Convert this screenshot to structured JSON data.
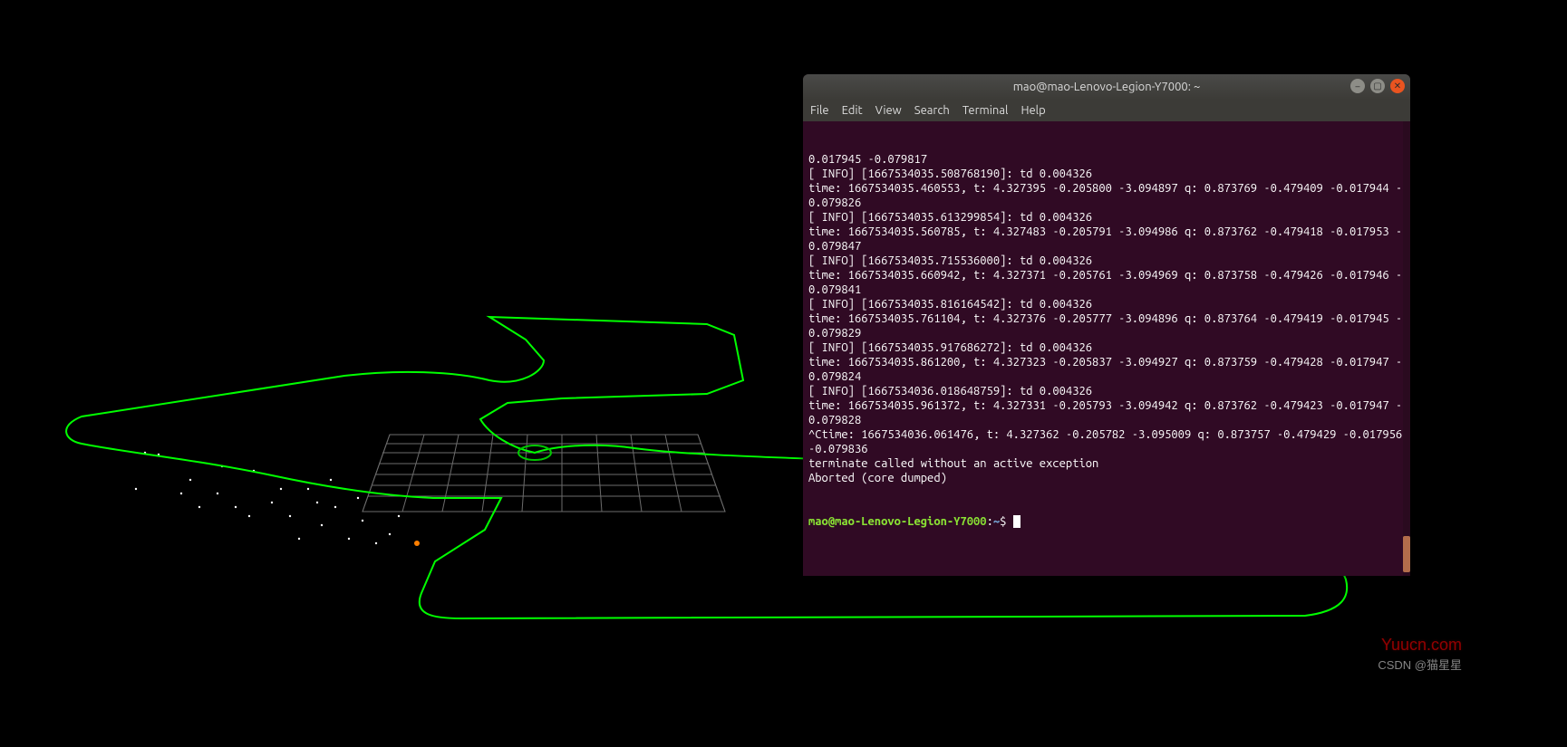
{
  "viewer": {
    "trajectory_color": "#00ff00",
    "grid_color": "#6c6c6c",
    "point_color": "#ffffff",
    "origin_marker_color": "#ff7f00"
  },
  "terminal": {
    "title": "mao@mao-Lenovo-Legion-Y7000: ~",
    "menu": {
      "file": "File",
      "edit": "Edit",
      "view": "View",
      "search": "Search",
      "terminal": "Terminal",
      "help": "Help"
    },
    "lines": [
      "0.017945 -0.079817",
      "[ INFO] [1667534035.508768190]: td 0.004326",
      "time: 1667534035.460553, t: 4.327395 -0.205800 -3.094897 q: 0.873769 -0.479409 -0.017944 -0.079826",
      "[ INFO] [1667534035.613299854]: td 0.004326",
      "time: 1667534035.560785, t: 4.327483 -0.205791 -3.094986 q: 0.873762 -0.479418 -0.017953 -0.079847",
      "[ INFO] [1667534035.715536000]: td 0.004326",
      "time: 1667534035.660942, t: 4.327371 -0.205761 -3.094969 q: 0.873758 -0.479426 -0.017946 -0.079841",
      "[ INFO] [1667534035.816164542]: td 0.004326",
      "time: 1667534035.761104, t: 4.327376 -0.205777 -3.094896 q: 0.873764 -0.479419 -0.017945 -0.079829",
      "[ INFO] [1667534035.917686272]: td 0.004326",
      "time: 1667534035.861200, t: 4.327323 -0.205837 -3.094927 q: 0.873759 -0.479428 -0.017947 -0.079824",
      "[ INFO] [1667534036.018648759]: td 0.004326",
      "time: 1667534035.961372, t: 4.327331 -0.205793 -3.094942 q: 0.873762 -0.479423 -0.017947 -0.079828",
      "^Ctime: 1667534036.061476, t: 4.327362 -0.205782 -3.095009 q: 0.873757 -0.479429 -0.017956 -0.079836",
      "terminate called without an active exception",
      "Aborted (core dumped)"
    ],
    "prompt": {
      "user_host": "mao@mao-Lenovo-Legion-Y7000",
      "colon": ":",
      "path": "~",
      "dollar": "$"
    }
  },
  "watermarks": {
    "site": "Yuucn.com",
    "author": "CSDN @猫星星"
  },
  "win_controls": {
    "minimize_glyph": "–",
    "maximize_glyph": "▢",
    "close_glyph": "✕"
  }
}
